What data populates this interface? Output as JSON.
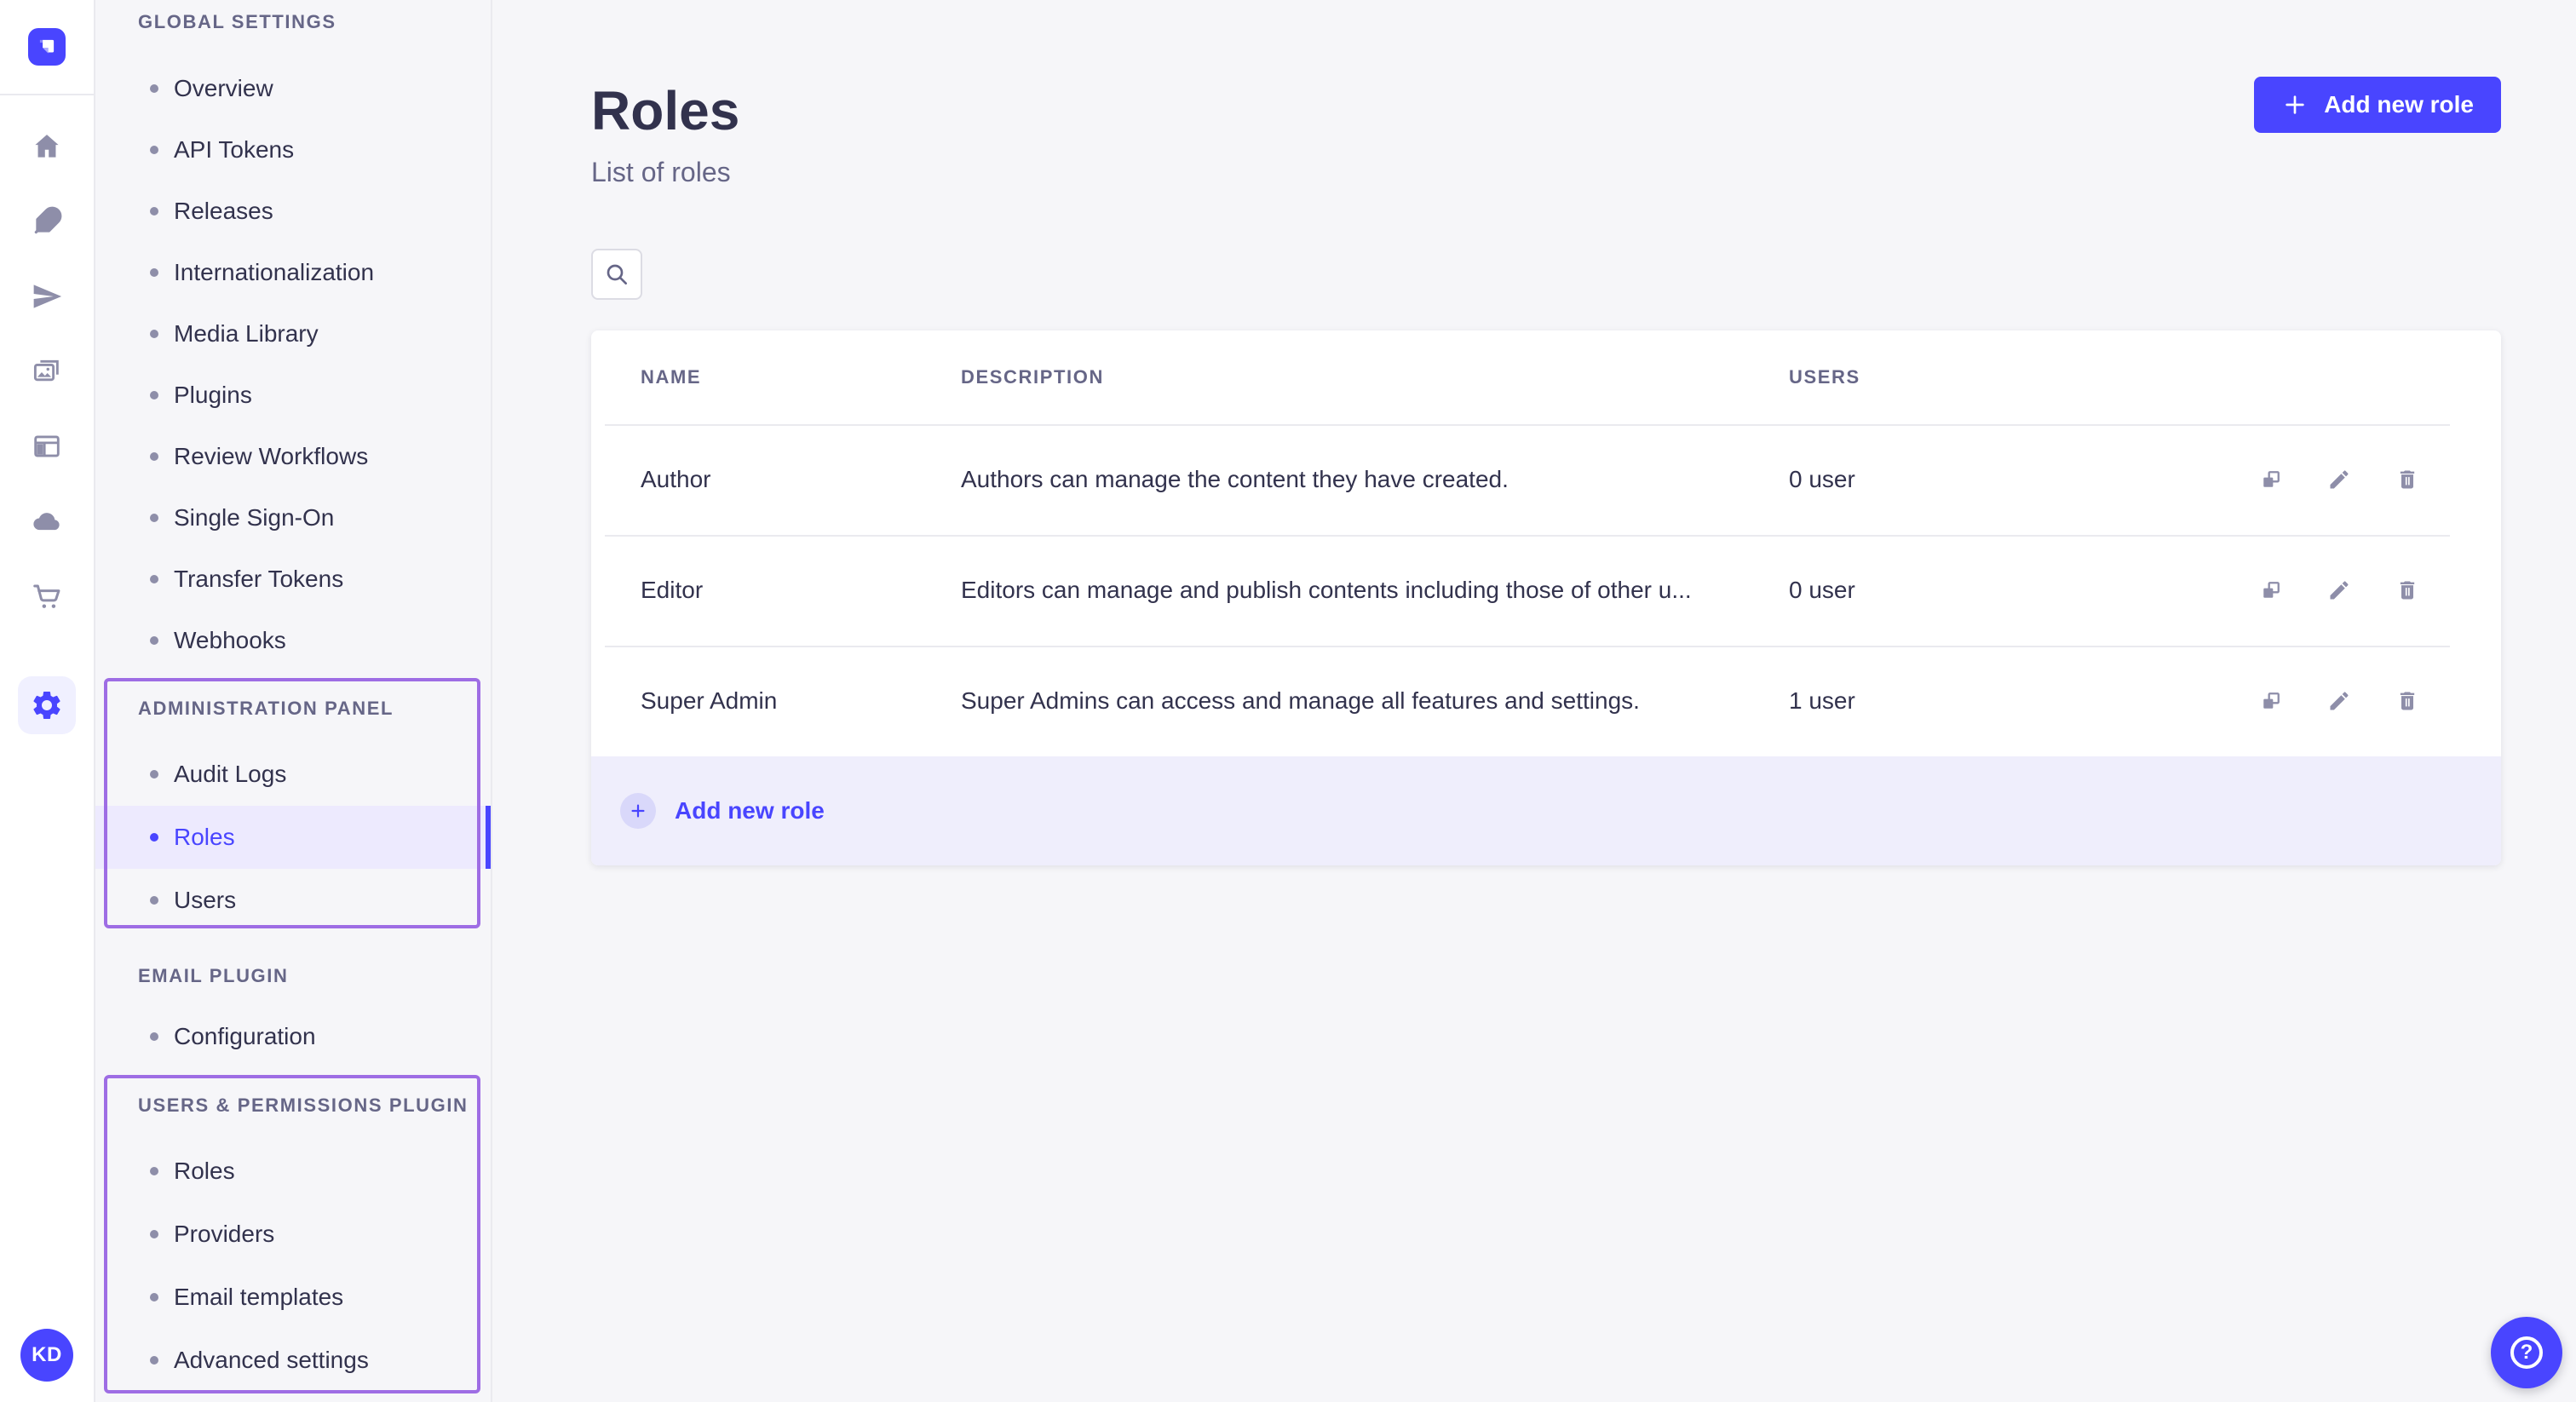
{
  "rail": {
    "icons": [
      "home",
      "content-manager",
      "deploy",
      "media-library",
      "content-type-builder",
      "cloud",
      "marketplace",
      "settings"
    ],
    "active_icon": "settings",
    "avatar_initials": "KD"
  },
  "subnav": {
    "sections": [
      {
        "label": "GLOBAL SETTINGS",
        "items": [
          "Overview",
          "API Tokens",
          "Releases",
          "Internationalization",
          "Media Library",
          "Plugins",
          "Review Workflows",
          "Single Sign-On",
          "Transfer Tokens",
          "Webhooks"
        ]
      },
      {
        "label": "ADMINISTRATION PANEL",
        "annotated": true,
        "active_item": "Roles",
        "items": [
          "Audit Logs",
          "Roles",
          "Users"
        ]
      },
      {
        "label": "EMAIL PLUGIN",
        "items": [
          "Configuration"
        ]
      },
      {
        "label": "USERS & PERMISSIONS PLUGIN",
        "annotated": true,
        "items": [
          "Roles",
          "Providers",
          "Email templates",
          "Advanced settings"
        ]
      }
    ]
  },
  "page": {
    "title": "Roles",
    "subtitle": "List of roles",
    "add_button_label": "Add new role"
  },
  "search": {
    "icon": "search-icon"
  },
  "table": {
    "columns": [
      "NAME",
      "DESCRIPTION",
      "USERS"
    ],
    "rows": [
      {
        "name": "Author",
        "description": "Authors can manage the content they have created.",
        "users": "0 user"
      },
      {
        "name": "Editor",
        "description": "Editors can manage and publish contents including those of other u...",
        "users": "0 user"
      },
      {
        "name": "Super Admin",
        "description": "Super Admins can access and manage all features and settings.",
        "users": "1 user"
      }
    ],
    "row_action_icons": [
      "duplicate-icon",
      "edit-icon",
      "delete-icon"
    ],
    "footer_action_label": "Add new role"
  },
  "help": {
    "glyph": "?"
  },
  "colors": {
    "primary": "#4945ff",
    "annotation_purple": "#9e6de4",
    "active_item_bg": "#edeafe",
    "footer_row_bg": "#efeefc",
    "plus_circle_bg": "#d9d8fa",
    "text_dark": "#32324d",
    "text_muted": "#666687",
    "border": "#eaeaef",
    "page_bg": "#f6f6f9"
  }
}
